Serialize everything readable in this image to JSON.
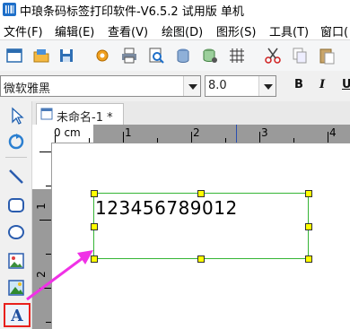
{
  "window": {
    "title": "中琅条码标签打印软件-V6.5.2 试用版 单机"
  },
  "menu": [
    {
      "label": "文件(F)"
    },
    {
      "label": "编辑(E)"
    },
    {
      "label": "查看(V)"
    },
    {
      "label": "绘图(D)"
    },
    {
      "label": "图形(S)"
    },
    {
      "label": "工具(T)"
    },
    {
      "label": "窗口("
    }
  ],
  "toolbar": {
    "icons": [
      "new-icon",
      "open-icon",
      "save-icon",
      "settings-icon",
      "print-icon",
      "print-preview-icon",
      "database-icon",
      "database-settings-icon",
      "grid-icon",
      "cut-icon",
      "copy-icon",
      "paste-icon"
    ]
  },
  "fontbar": {
    "font_name": "微软雅黑",
    "font_size": "8.0",
    "bold": "B",
    "italic": "I",
    "underline": "U"
  },
  "left_tools": [
    "select-icon",
    "rotate-icon",
    "line-icon",
    "rounded-rect-icon",
    "ellipse-icon",
    "image-icon",
    "picture-icon",
    "text-icon"
  ],
  "tab": {
    "label": "未命名-1 *"
  },
  "ruler": {
    "unit": "0 cm",
    "h_marks": [
      "1",
      "2",
      "3",
      "4"
    ],
    "v_marks": [
      "1",
      "2"
    ]
  },
  "canvas": {
    "text_object": "123456789012"
  },
  "colors": {
    "selection_border": "#35b535",
    "handle": "#ffff00",
    "arrow": "#f032e6",
    "tool_highlight": "#e8201c"
  }
}
